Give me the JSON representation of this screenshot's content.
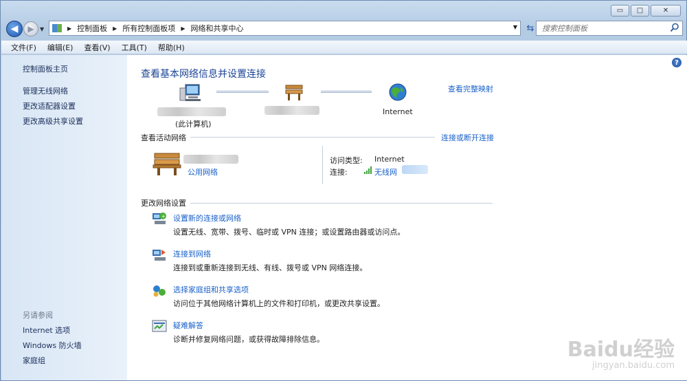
{
  "window": {
    "controls": {
      "minimize": "▭",
      "maximize": "□",
      "close": "✕"
    }
  },
  "navbar": {
    "back_glyph": "◀",
    "forward_glyph": "▶",
    "breadcrumbs": [
      "控制面板",
      "所有控制面板项",
      "网络和共享中心"
    ],
    "search_placeholder": "搜索控制面板"
  },
  "menu": [
    "文件(F)",
    "编辑(E)",
    "查看(V)",
    "工具(T)",
    "帮助(H)"
  ],
  "sidebar": {
    "home": "控制面板主页",
    "links": [
      "管理无线网络",
      "更改适配器设置",
      "更改高级共享设置"
    ],
    "see_also_heading": "另请参阅",
    "see_also": [
      "Internet 选项",
      "Windows 防火墙",
      "家庭组"
    ]
  },
  "main": {
    "title": "查看基本网络信息并设置连接",
    "full_map_link": "查看完整映射",
    "map": {
      "this_computer_label": "(此计算机)",
      "internet_label": "Internet"
    },
    "active_networks": {
      "heading": "查看活动网络",
      "connect_link": "连接或断开连接",
      "network_type": "公用网络",
      "access_type_label": "访问类型:",
      "access_type_value": "Internet",
      "connection_label": "连接:",
      "connection_value": "无线网"
    },
    "change_settings": {
      "heading": "更改网络设置",
      "tasks": [
        {
          "title": "设置新的连接或网络",
          "desc": "设置无线、宽带、拨号、临时或 VPN 连接；或设置路由器或访问点。"
        },
        {
          "title": "连接到网络",
          "desc": "连接到或重新连接到无线、有线、拨号或 VPN 网络连接。"
        },
        {
          "title": "选择家庭组和共享选项",
          "desc": "访问位于其他网络计算机上的文件和打印机，或更改共享设置。"
        },
        {
          "title": "疑难解答",
          "desc": "诊断并修复网络问题，或获得故障排除信息。"
        }
      ]
    }
  },
  "watermark": {
    "brand": "Baidu经验",
    "url": "jingyan.baidu.com"
  },
  "colors": {
    "link": "#1a61c9",
    "title": "#1d4596",
    "sidebar_text": "#1b2f5a"
  }
}
